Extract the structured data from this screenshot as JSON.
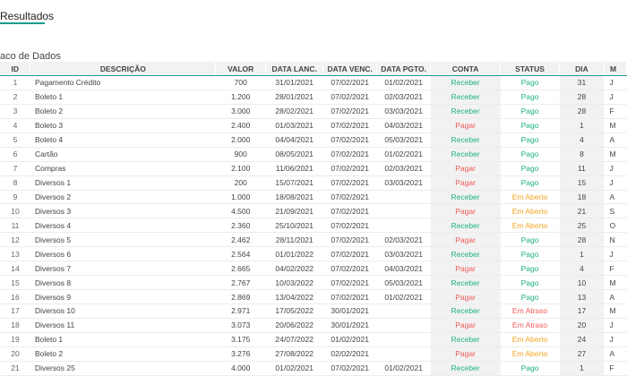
{
  "tab": {
    "label": "Resultados"
  },
  "section": {
    "title": "aco de Dados"
  },
  "columns": [
    "ID",
    "DESCRIÇÃO",
    "VALOR",
    "DATA LANC.",
    "DATA VENC.",
    "DATA PGTO.",
    "CONTA",
    "STATUS",
    "DIA",
    "M"
  ],
  "colors": {
    "accent": "#1a9e8a",
    "receber": "#1fb37a",
    "pagar": "#f05a5a",
    "pago": "#1fb37a",
    "em_aberto": "#f5a623",
    "em_atraso": "#f05a5a"
  },
  "rows": [
    {
      "id": "1",
      "desc": "Pagamento Crédito",
      "valor": "700",
      "lanc": "31/01/2021",
      "venc": "07/02/2021",
      "pgto": "01/02/2021",
      "conta": "Receber",
      "status": "Pago",
      "dia": "31",
      "m": "J"
    },
    {
      "id": "2",
      "desc": "Boleto 1",
      "valor": "1.200",
      "lanc": "28/01/2021",
      "venc": "07/02/2021",
      "pgto": "02/03/2021",
      "conta": "Receber",
      "status": "Pago",
      "dia": "28",
      "m": "J"
    },
    {
      "id": "3",
      "desc": "Boleto 2",
      "valor": "3.000",
      "lanc": "28/02/2021",
      "venc": "07/02/2021",
      "pgto": "03/03/2021",
      "conta": "Receber",
      "status": "Pago",
      "dia": "28",
      "m": "F"
    },
    {
      "id": "4",
      "desc": "Boleto 3",
      "valor": "2.400",
      "lanc": "01/03/2021",
      "venc": "07/02/2021",
      "pgto": "04/03/2021",
      "conta": "Pagar",
      "status": "Pago",
      "dia": "1",
      "m": "M"
    },
    {
      "id": "5",
      "desc": "Boleto 4",
      "valor": "2.000",
      "lanc": "04/04/2021",
      "venc": "07/02/2021",
      "pgto": "05/03/2021",
      "conta": "Receber",
      "status": "Pago",
      "dia": "4",
      "m": "A"
    },
    {
      "id": "6",
      "desc": "Cartão",
      "valor": "900",
      "lanc": "08/05/2021",
      "venc": "07/02/2021",
      "pgto": "01/02/2021",
      "conta": "Receber",
      "status": "Pago",
      "dia": "8",
      "m": "M"
    },
    {
      "id": "7",
      "desc": "Compras",
      "valor": "2.100",
      "lanc": "11/06/2021",
      "venc": "07/02/2021",
      "pgto": "02/03/2021",
      "conta": "Pagar",
      "status": "Pago",
      "dia": "11",
      "m": "J"
    },
    {
      "id": "8",
      "desc": "Diversos 1",
      "valor": "200",
      "lanc": "15/07/2021",
      "venc": "07/02/2021",
      "pgto": "03/03/2021",
      "conta": "Pagar",
      "status": "Pago",
      "dia": "15",
      "m": "J"
    },
    {
      "id": "9",
      "desc": "Diversos 2",
      "valor": "1.000",
      "lanc": "18/08/2021",
      "venc": "07/02/2021",
      "pgto": "",
      "conta": "Receber",
      "status": "Em Aberto",
      "dia": "18",
      "m": "A"
    },
    {
      "id": "10",
      "desc": "Diversos 3",
      "valor": "4.500",
      "lanc": "21/09/2021",
      "venc": "07/02/2021",
      "pgto": "",
      "conta": "Pagar",
      "status": "Em Aberto",
      "dia": "21",
      "m": "S"
    },
    {
      "id": "11",
      "desc": "Diversos 4",
      "valor": "2.360",
      "lanc": "25/10/2021",
      "venc": "07/02/2021",
      "pgto": "",
      "conta": "Receber",
      "status": "Em Aberto",
      "dia": "25",
      "m": "O"
    },
    {
      "id": "12",
      "desc": "Diversos 5",
      "valor": "2.462",
      "lanc": "28/11/2021",
      "venc": "07/02/2021",
      "pgto": "02/03/2021",
      "conta": "Pagar",
      "status": "Pago",
      "dia": "28",
      "m": "N"
    },
    {
      "id": "13",
      "desc": "Diversos 6",
      "valor": "2.564",
      "lanc": "01/01/2022",
      "venc": "07/02/2021",
      "pgto": "03/03/2021",
      "conta": "Receber",
      "status": "Pago",
      "dia": "1",
      "m": "J"
    },
    {
      "id": "14",
      "desc": "Diversos 7",
      "valor": "2.665",
      "lanc": "04/02/2022",
      "venc": "07/02/2021",
      "pgto": "04/03/2021",
      "conta": "Pagar",
      "status": "Pago",
      "dia": "4",
      "m": "F"
    },
    {
      "id": "15",
      "desc": "Diversos 8",
      "valor": "2.767",
      "lanc": "10/03/2022",
      "venc": "07/02/2021",
      "pgto": "05/03/2021",
      "conta": "Receber",
      "status": "Pago",
      "dia": "10",
      "m": "M"
    },
    {
      "id": "16",
      "desc": "Diversos 9",
      "valor": "2.869",
      "lanc": "13/04/2022",
      "venc": "07/02/2021",
      "pgto": "01/02/2021",
      "conta": "Pagar",
      "status": "Pago",
      "dia": "13",
      "m": "A"
    },
    {
      "id": "17",
      "desc": "Diversos 10",
      "valor": "2.971",
      "lanc": "17/05/2022",
      "venc": "30/01/2021",
      "pgto": "",
      "conta": "Receber",
      "status": "Em Atraso",
      "dia": "17",
      "m": "M"
    },
    {
      "id": "18",
      "desc": "Diversos 11",
      "valor": "3.073",
      "lanc": "20/06/2022",
      "venc": "30/01/2021",
      "pgto": "",
      "conta": "Pagar",
      "status": "Em Atraso",
      "dia": "20",
      "m": "J"
    },
    {
      "id": "19",
      "desc": "Boleto 1",
      "valor": "3.175",
      "lanc": "24/07/2022",
      "venc": "01/02/2021",
      "pgto": "",
      "conta": "Receber",
      "status": "Em Aberto",
      "dia": "24",
      "m": "J"
    },
    {
      "id": "20",
      "desc": "Boleto 2",
      "valor": "3.276",
      "lanc": "27/08/2022",
      "venc": "02/02/2021",
      "pgto": "",
      "conta": "Pagar",
      "status": "Em Aberto",
      "dia": "27",
      "m": "A"
    },
    {
      "id": "21",
      "desc": "Diversos 25",
      "valor": "4.000",
      "lanc": "01/02/2021",
      "venc": "07/02/2021",
      "pgto": "01/02/2021",
      "conta": "Receber",
      "status": "Pago",
      "dia": "1",
      "m": "F"
    }
  ]
}
